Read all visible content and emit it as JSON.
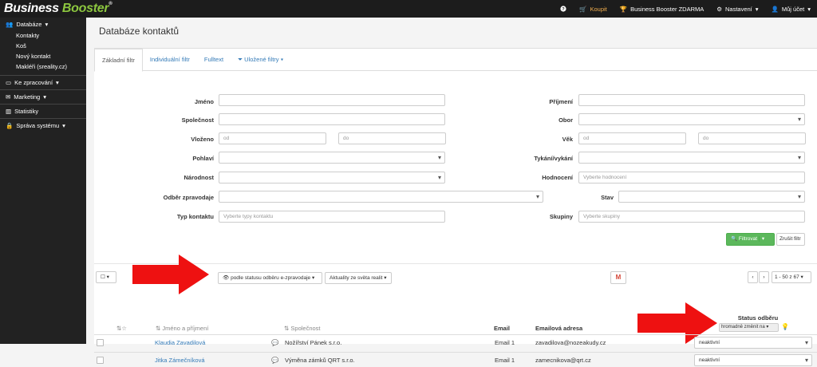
{
  "topbar": {
    "logo_part1": "Business",
    "logo_part2": "Booster",
    "logo_reg": "®",
    "help_icon": "question-circle-icon",
    "buy_label": "Koupit",
    "free_label": "Business Booster ZDARMA",
    "settings_label": "Nastavení",
    "account_label": "Můj účet",
    "colors": {
      "bg": "#1c1c1c",
      "brand_green": "#8cc63f",
      "buy": "#f0ad4e"
    }
  },
  "sidebar": {
    "database": {
      "label": "Databáze",
      "items": [
        "Kontakty",
        "Koš",
        "Nový kontakt",
        "Makléři (sreality.cz)"
      ]
    },
    "processing": "Ke zpracování",
    "marketing": "Marketing",
    "statistics": "Statistiky",
    "admin": "Správa systému"
  },
  "page": {
    "title": "Databáze kontaktů"
  },
  "tabs": [
    "Základní filtr",
    "Individuální filtr",
    "Fulltext",
    "Uložené filtry"
  ],
  "filter": {
    "jmeno": "Jméno",
    "prijmeni": "Příjmení",
    "spolecnost": "Společnost",
    "obor": "Obor",
    "vlozeno": "Vloženo",
    "vek": "Věk",
    "od": "od",
    "do": "do",
    "pohlavi": "Pohlaví",
    "tykani": "Tykání/vykání",
    "narodnost": "Národnost",
    "hodnoceni": "Hodnocení",
    "hodnoceni_ph": "Vyberte hodnocení",
    "odber": "Odběr zpravodaje",
    "stav": "Stav",
    "typ": "Typ kontaktu",
    "typ_ph": "Vyberte typy kontaktu",
    "skupiny": "Skupiny",
    "skupiny_ph": "Vyberte skupiny",
    "filter_btn": "Filtrovat",
    "reset_btn": "Zrušit filtr"
  },
  "toolbar": {
    "status_btn": "podle statusu odběru e-zpravodaje",
    "news_btn": "Aktuality ze světa realit",
    "pager": "1 - 50 z 67",
    "gmail_icon": "gmail-icon"
  },
  "table": {
    "status_header": "Status odběru",
    "bulk_change": "hromadně změnit na",
    "headers": {
      "name": "Jméno a příjmení",
      "company": "Společnost",
      "email_type": "Email",
      "email": "Emailová adresa"
    },
    "rows": [
      {
        "name": "Klaudia Zavadilová",
        "company": "Nožířství Pánek s.r.o.",
        "email_type": "Email 1",
        "email": "zavadilova@nozeakudy.cz",
        "status": "neaktivní"
      },
      {
        "name": "Jitka Zámečníková",
        "company": "Výměna zámků QRT s.r.o.",
        "email_type": "Email 1",
        "email": "zamecnikova@qrt.cz",
        "status": "neaktivní"
      }
    ]
  }
}
